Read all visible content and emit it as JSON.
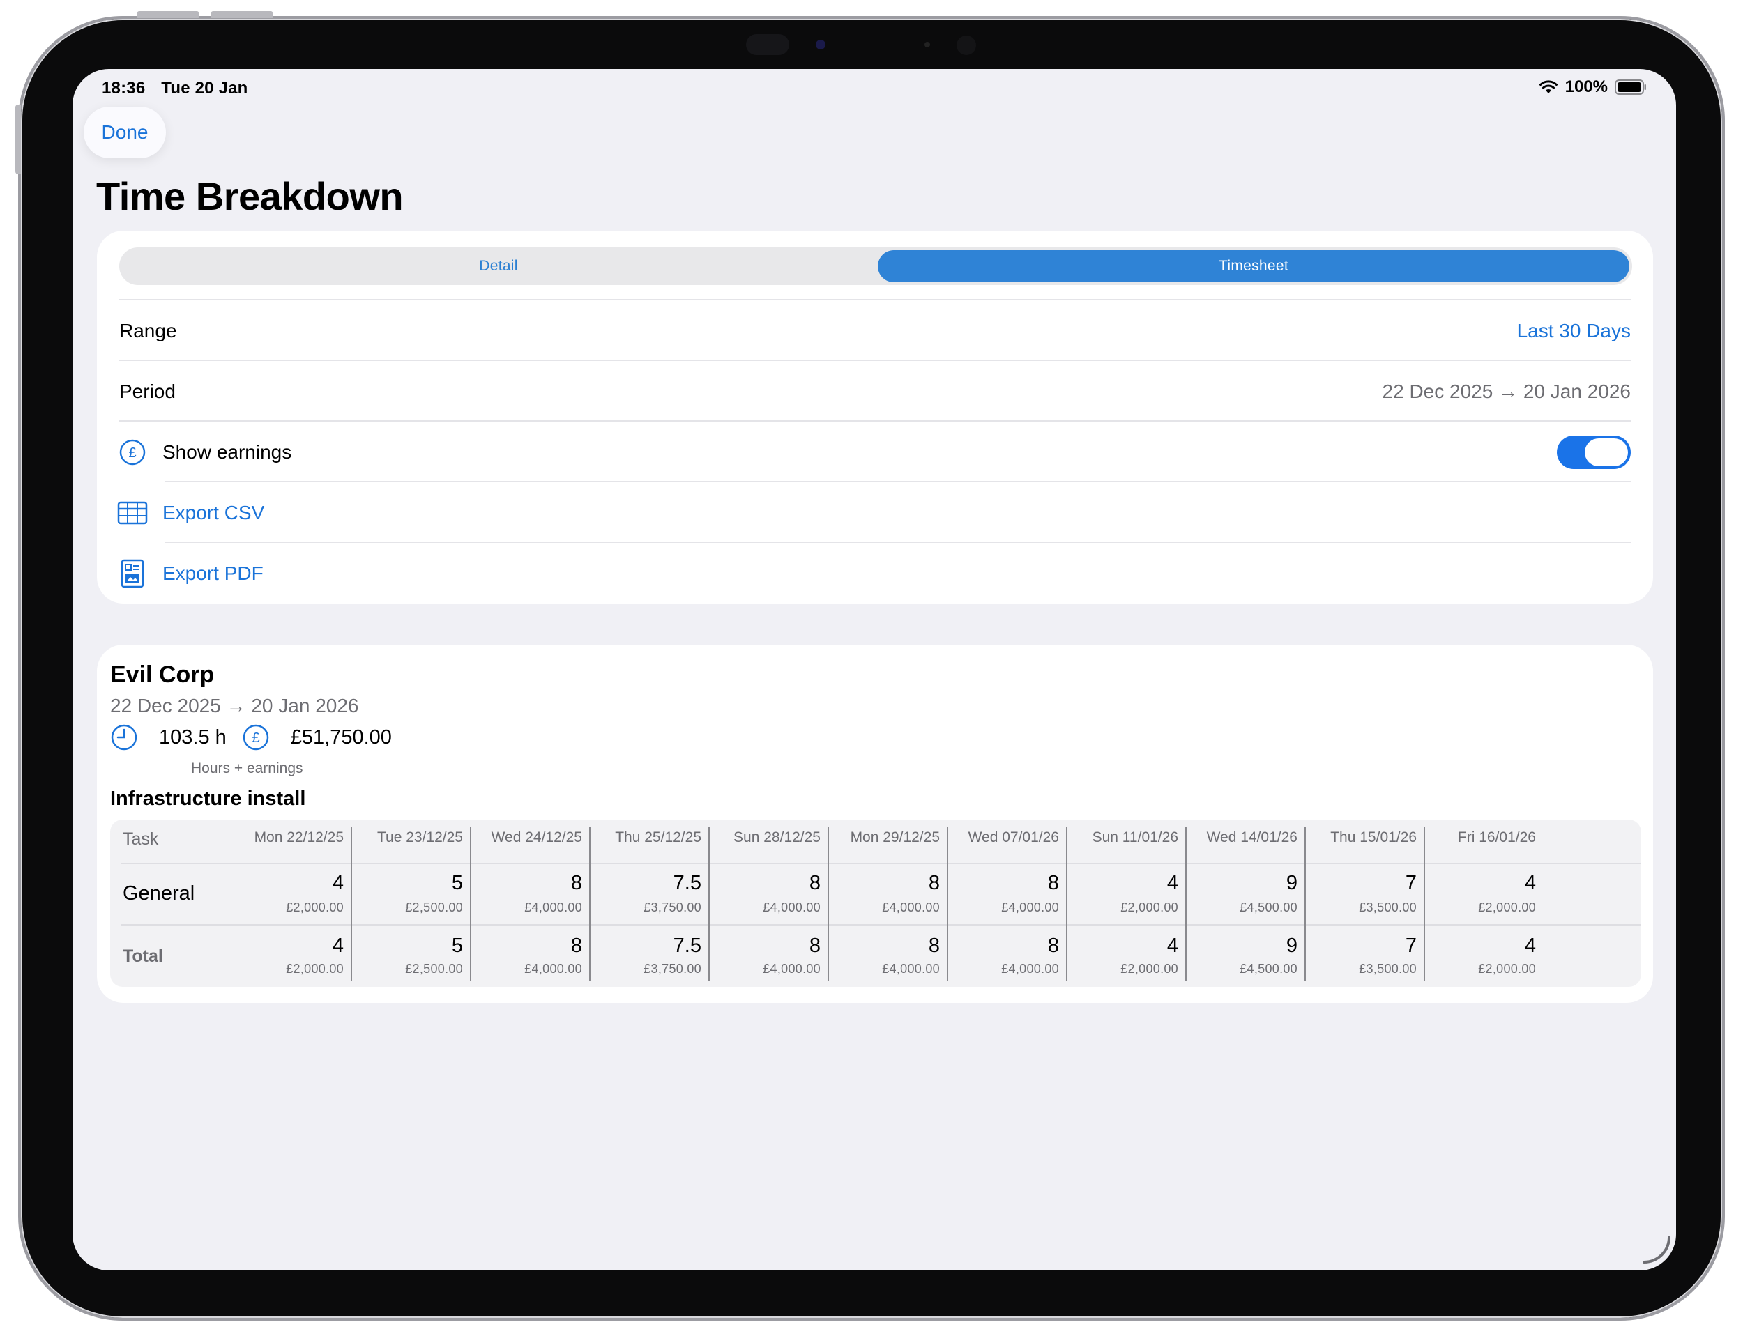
{
  "status_bar": {
    "time": "18:36",
    "date": "Tue 20 Jan",
    "battery": "100%"
  },
  "nav": {
    "done_label": "Done",
    "title": "Time Breakdown"
  },
  "segments": {
    "detail": "Detail",
    "timesheet": "Timesheet",
    "selected": "Timesheet"
  },
  "settings": {
    "range_label": "Range",
    "range_value": "Last 30 Days",
    "period_label": "Period",
    "period_value": "22 Dec 2025 → 20 Jan 2026",
    "show_earnings_label": "Show earnings",
    "show_earnings_on": true,
    "export_csv_label": "Export CSV",
    "export_pdf_label": "Export PDF"
  },
  "client": {
    "name": "Evil Corp",
    "period": "22 Dec 2025 → 20 Jan 2026",
    "hours": "103.5 h",
    "earnings": "£51,750.00",
    "stats_caption": "Hours + earnings",
    "project": "Infrastructure install"
  },
  "timesheet": {
    "task_header": "Task",
    "columns": [
      "Mon 22/12/25",
      "Tue 23/12/25",
      "Wed 24/12/25",
      "Thu 25/12/25",
      "Sun 28/12/25",
      "Mon 29/12/25",
      "Wed 07/01/26",
      "Sun 11/01/26",
      "Wed 14/01/26",
      "Thu 15/01/26",
      "Fri 16/01/26"
    ],
    "rows": [
      {
        "label": "General",
        "hours": [
          "4",
          "5",
          "8",
          "7.5",
          "8",
          "8",
          "8",
          "4",
          "9",
          "7",
          "4"
        ],
        "money": [
          "£2,000.00",
          "£2,500.00",
          "£4,000.00",
          "£3,750.00",
          "£4,000.00",
          "£4,000.00",
          "£4,000.00",
          "£2,000.00",
          "£4,500.00",
          "£3,500.00",
          "£2,000.00"
        ]
      }
    ],
    "total": {
      "label": "Total",
      "hours": [
        "4",
        "5",
        "8",
        "7.5",
        "8",
        "8",
        "8",
        "4",
        "9",
        "7",
        "4"
      ],
      "money": [
        "£2,000.00",
        "£2,500.00",
        "£4,000.00",
        "£3,750.00",
        "£4,000.00",
        "£4,000.00",
        "£4,000.00",
        "£2,000.00",
        "£4,500.00",
        "£3,500.00",
        "£2,000.00"
      ]
    }
  },
  "colors": {
    "accent": "#1a73d9",
    "segment_selected": "#2f83d6",
    "toggle_on": "#1a73e8",
    "background": "#f0f0f5"
  }
}
